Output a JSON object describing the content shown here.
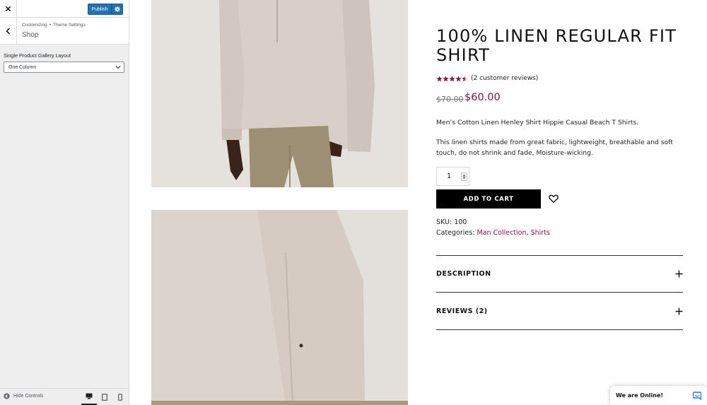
{
  "customizer": {
    "publish_label": "Publish",
    "breadcrumb": [
      "Customizing",
      "Theme Settings"
    ],
    "breadcrumb_separator": "•",
    "section_title": "Shop",
    "control_label": "Single Product Gallery Layout",
    "gallery_layout_selected": "One Column",
    "hide_controls_label": "Hide Controls",
    "accent_color": "#2271b1"
  },
  "product": {
    "title": "100% LINEN REGULAR FIT SHIRT",
    "rating": 4.5,
    "rating_max": 5,
    "reviews_link": "(2 customer reviews)",
    "price_old": "$70.00",
    "price_new": "$60.00",
    "description_1": "Men’s Cotton Linen Henley Shirt Hippie Casual Beach T Shirts.",
    "description_2": "This linen shirts made from great fabric, lightweight, breathable and soft touch, do not shrink and fade, Moisture-wicking.",
    "quantity": "1",
    "add_to_cart_label": "ADD TO CART",
    "sku_label": "SKU:",
    "sku_value": "100",
    "categories_label": "Categories:",
    "categories": [
      "Man Collection",
      "Shirts"
    ],
    "accent_color": "#8b1044",
    "accordion": [
      {
        "label": "DESCRIPTION"
      },
      {
        "label": "REVIEWS (2)"
      }
    ]
  },
  "chat": {
    "label": "We are Online!",
    "icon": "chat-bubble-icon",
    "color": "#1972f5"
  }
}
